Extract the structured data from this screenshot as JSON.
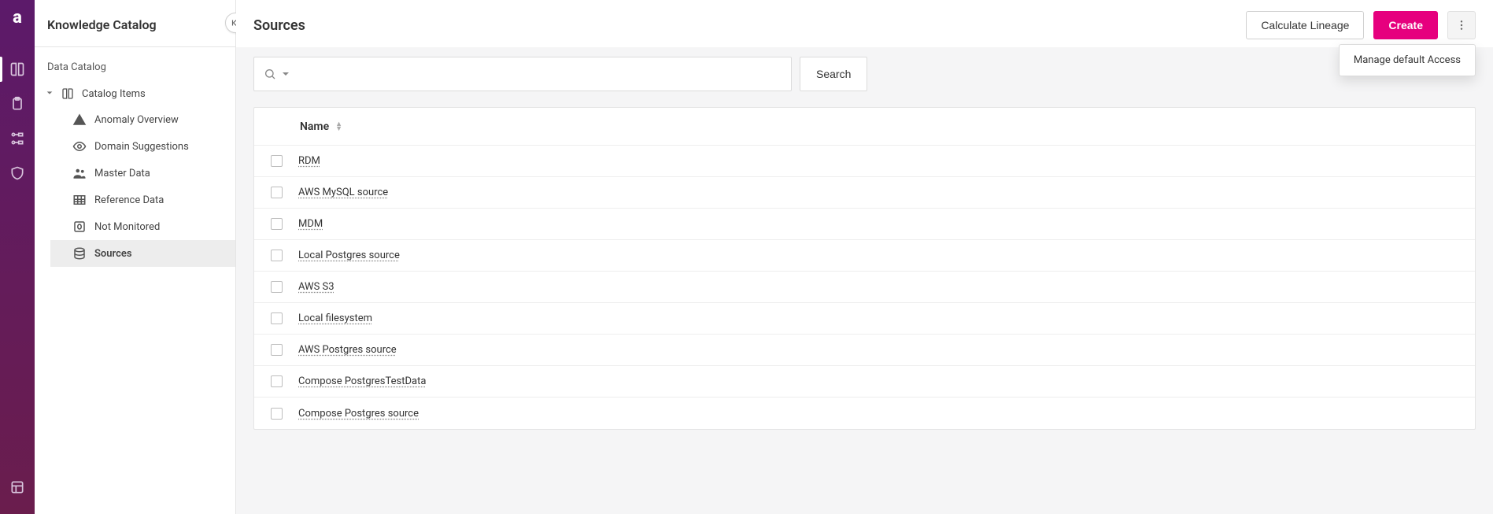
{
  "app": {
    "brand_glyph": "a"
  },
  "sidebar": {
    "title": "Knowledge Catalog",
    "section_title": "Data Catalog",
    "root": {
      "label": "Catalog Items"
    },
    "items": [
      {
        "label": "Anomaly Overview",
        "icon": "warning-icon"
      },
      {
        "label": "Domain Suggestions",
        "icon": "eye-icon"
      },
      {
        "label": "Master Data",
        "icon": "people-icon"
      },
      {
        "label": "Reference Data",
        "icon": "grid-icon"
      },
      {
        "label": "Not Monitored",
        "icon": "zero-box-icon"
      },
      {
        "label": "Sources",
        "icon": "database-icon",
        "active": true
      }
    ]
  },
  "header": {
    "title": "Sources",
    "calculate_label": "Calculate Lineage",
    "create_label": "Create",
    "menu_item": "Manage default Access"
  },
  "search": {
    "button_label": "Search",
    "placeholder": ""
  },
  "table": {
    "columns": {
      "name": "Name"
    },
    "rows": [
      {
        "name": "RDM"
      },
      {
        "name": "AWS MySQL source"
      },
      {
        "name": "MDM"
      },
      {
        "name": "Local Postgres source"
      },
      {
        "name": "AWS S3"
      },
      {
        "name": "Local filesystem"
      },
      {
        "name": "AWS Postgres source"
      },
      {
        "name": "Compose PostgresTestData"
      },
      {
        "name": "Compose Postgres source"
      }
    ]
  }
}
